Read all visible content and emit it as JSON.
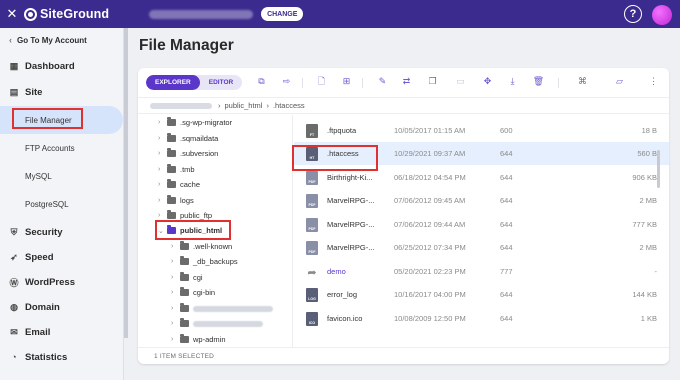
{
  "topbar": {
    "brand": "SiteGround",
    "change_label": "CHANGE",
    "help_label": "?"
  },
  "sidebar": {
    "back_label": "Go To My Account",
    "sections": [
      {
        "label": "Dashboard",
        "icon": "dashboard-icon"
      },
      {
        "label": "Site",
        "icon": "site-icon"
      }
    ],
    "site_items": [
      "File Manager",
      "FTP Accounts",
      "MySQL",
      "PostgreSQL"
    ],
    "sections_after": [
      {
        "label": "Security",
        "icon": "shield-icon"
      },
      {
        "label": "Speed",
        "icon": "rocket-icon"
      },
      {
        "label": "WordPress",
        "icon": "wordpress-icon"
      },
      {
        "label": "Domain",
        "icon": "globe-icon"
      },
      {
        "label": "Email",
        "icon": "mail-icon"
      },
      {
        "label": "Statistics",
        "icon": "stats-icon"
      }
    ]
  },
  "main": {
    "title": "File Manager",
    "tabs": {
      "explorer": "EXPLORER",
      "editor": "EDITOR"
    },
    "breadcrumb": [
      "public_html",
      ".htaccess"
    ],
    "tree": [
      ".sg-wp-migrator",
      ".sqmaildata",
      ".subversion",
      ".tmb",
      "cache",
      "logs",
      "public_ftp",
      "public_html",
      ".well-known",
      "_db_backups",
      "cgi",
      "cgi-bin",
      "wp-admin"
    ],
    "files": [
      {
        "name": ".ftpquota",
        "date": "10/05/2017 01:15 AM",
        "perm": "600",
        "size": "18 B",
        "type": "FT"
      },
      {
        "name": ".htaccess",
        "date": "10/29/2021 09:37 AM",
        "perm": "644",
        "size": "560 B",
        "type": "HT"
      },
      {
        "name": "Birthright-Ki...",
        "date": "06/18/2012 04:54 PM",
        "perm": "644",
        "size": "906 KB",
        "type": "PDF"
      },
      {
        "name": "MarvelRPG-...",
        "date": "07/06/2012 09:45 AM",
        "perm": "644",
        "size": "2 MB",
        "type": "PDF"
      },
      {
        "name": "MarvelRPG-...",
        "date": "07/06/2012 09:44 AM",
        "perm": "644",
        "size": "777 KB",
        "type": "PDF"
      },
      {
        "name": "MarvelRPG-...",
        "date": "06/25/2012 07:34 PM",
        "perm": "644",
        "size": "2 MB",
        "type": "PDF"
      },
      {
        "name": "demo",
        "date": "05/20/2021 02:23 PM",
        "perm": "777",
        "size": "-",
        "type": "LINK"
      },
      {
        "name": "error_log",
        "date": "10/16/2017 04:00 PM",
        "perm": "644",
        "size": "144 KB",
        "type": "LOG"
      },
      {
        "name": "favicon.ico",
        "date": "10/08/2009 12:50 PM",
        "perm": "644",
        "size": "1 KB",
        "type": "ICO"
      }
    ],
    "status": "1 ITEM SELECTED"
  }
}
